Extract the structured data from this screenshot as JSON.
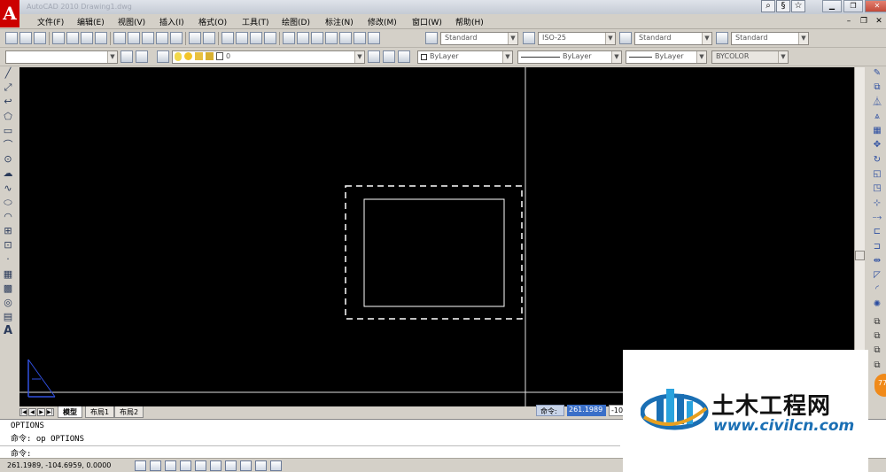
{
  "window": {
    "title": "AutoCAD 2010  Drawing1.dwg",
    "logo": "A",
    "title_icons": [
      "search-icon",
      "help-exchange-icon",
      "favorite-star-icon"
    ]
  },
  "menus": [
    "文件(F)",
    "编辑(E)",
    "视图(V)",
    "插入(I)",
    "格式(O)",
    "工具(T)",
    "绘图(D)",
    "标注(N)",
    "修改(M)",
    "窗口(W)",
    "帮助(H)"
  ],
  "styles": {
    "text_style": "Standard",
    "dim_style": "ISO-25",
    "table_style": "Standard",
    "multileader_style": "Standard"
  },
  "layers": {
    "workspace": "",
    "current_layer": "0",
    "color": "ByLayer",
    "linetype": "ByLayer",
    "lineweight": "ByLayer",
    "plot_style": "BYCOLOR"
  },
  "left_tool_icons": [
    "line-icon",
    "construction-line-icon",
    "polyline-icon",
    "polygon-icon",
    "rectangle-icon",
    "arc-icon",
    "circle-icon",
    "revision-cloud-icon",
    "spline-icon",
    "ellipse-icon",
    "ellipse-arc-icon",
    "insert-block-icon",
    "make-block-icon",
    "point-icon",
    "hatch-icon",
    "gradient-icon",
    "region-icon",
    "table-icon",
    "multiline-text-icon"
  ],
  "right_tool_icons": [
    "erase-icon",
    "copy-icon",
    "mirror-icon",
    "offset-icon",
    "array-icon",
    "move-icon",
    "rotate-icon",
    "scale-icon",
    "stretch-icon",
    "trim-icon",
    "extend-icon",
    "break-at-point-icon",
    "break-icon",
    "join-icon",
    "chamfer-icon",
    "fillet-icon",
    "explode-icon",
    "draw-order-front-icon",
    "draw-order-back-icon",
    "bring-above-icon",
    "send-under-icon"
  ],
  "layout_tabs": [
    "模型",
    "布局1",
    "布局2"
  ],
  "command_panel": {
    "label": "命令:",
    "value": "261.1989",
    "next_value": "-10"
  },
  "command_history": [
    "OPTIONS",
    "命令: op OPTIONS",
    "命令:"
  ],
  "status": {
    "coordinates": "261.1989, -104.6959, 0.0000"
  },
  "watermark": {
    "title": "土木工程网",
    "url": "www.civilcn.com"
  },
  "badge": "77"
}
